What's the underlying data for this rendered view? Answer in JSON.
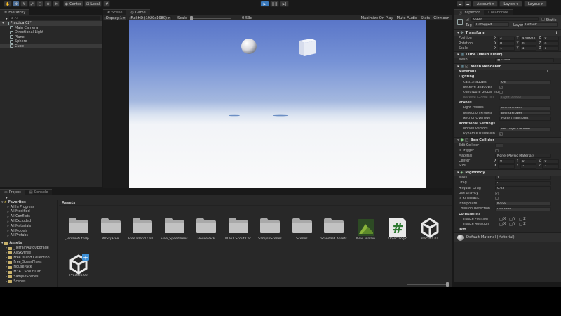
{
  "toolbar": {
    "pivot": "Center",
    "space": "Local",
    "account": "Account",
    "layers": "Layers",
    "layout": "Layout"
  },
  "hierarchy": {
    "tab": "Hierarchy",
    "search_placeholder": "All",
    "scene": "Practica 02*",
    "items": [
      "Main Camera",
      "Directional Light",
      "Plane",
      "Sphere",
      "Cube"
    ]
  },
  "game": {
    "tabs": [
      "Scene",
      "Game"
    ],
    "display": "Display 1",
    "resolution": "Full HD (1920x1080)",
    "scale_label": "Scale",
    "scale_value": "0.53x",
    "options": [
      "Maximize On Play",
      "Mute Audio",
      "Stats",
      "Gizmos"
    ]
  },
  "inspector": {
    "tabs": [
      "Inspector",
      "Collaborate"
    ],
    "object_name": "Cube",
    "static_label": "Static",
    "tag_label": "Tag",
    "tag_value": "Untagged",
    "layer_label": "Layer",
    "layer_value": "Default",
    "transform": {
      "title": "Transform",
      "position": {
        "label": "Position",
        "x": "2",
        "y": "4.98622",
        "z": "0"
      },
      "rotation": {
        "label": "Rotation",
        "x": "0",
        "y": "0",
        "z": "0"
      },
      "scale": {
        "label": "Scale",
        "x": "1",
        "y": "1",
        "z": "1"
      }
    },
    "mesh_filter": {
      "title": "Cube (Mesh Filter)",
      "mesh_label": "Mesh",
      "mesh_value": "Cube"
    },
    "mesh_renderer": {
      "title": "Mesh Renderer",
      "materials_label": "Materials",
      "materials_count": "1",
      "lighting_label": "Lighting",
      "cast_shadows_label": "Cast Shadows",
      "cast_shadows_value": "On",
      "receive_shadows_label": "Receive Shadows",
      "contribute_gi_label": "Contribute Global Illu",
      "receive_gi_label": "Receive Global Illu",
      "receive_gi_value": "Light Probes",
      "probes_label": "Probes",
      "light_probes_label": "Light Probes",
      "light_probes_value": "Blend Probes",
      "reflection_probes_label": "Reflection Probes",
      "reflection_probes_value": "Blend Probes",
      "anchor_override_label": "Anchor Override",
      "anchor_override_value": "None (Transform)",
      "additional_label": "Additional Settings",
      "motion_vectors_label": "Motion Vectors",
      "motion_vectors_value": "Per Object Motion",
      "dynamic_occlusion_label": "Dynamic Occlusion"
    },
    "box_collider": {
      "title": "Box Collider",
      "edit_collider_label": "Edit Collider",
      "is_trigger_label": "Is Trigger",
      "material_label": "Material",
      "material_value": "None (Physic Material)",
      "center": {
        "label": "Center",
        "x": "0",
        "y": "0",
        "z": "0"
      },
      "size": {
        "label": "Size",
        "x": "1",
        "y": "1",
        "z": "1"
      }
    },
    "rigidbody": {
      "title": "Rigidbody",
      "mass_label": "Mass",
      "mass_value": "1",
      "drag_label": "Drag",
      "drag_value": "0",
      "angular_drag_label": "Angular Drag",
      "angular_drag_value": "0.05",
      "use_gravity_label": "Use Gravity",
      "is_kinematic_label": "Is Kinematic",
      "interpolate_label": "Interpolate",
      "interpolate_value": "None",
      "collision_label": "Collision Detection",
      "collision_value": "Discrete",
      "constraints_label": "Constraints",
      "freeze_position_label": "Freeze Position",
      "freeze_rotation_label": "Freeze Rotation",
      "axes": [
        "X",
        "Y",
        "Z"
      ],
      "info_label": "Info"
    },
    "material": {
      "title": "Default-Material (Material)"
    }
  },
  "project": {
    "tabs": [
      "Project",
      "Console"
    ],
    "favorites_label": "Favorites",
    "favorites": [
      "All In Progress",
      "All Modified",
      "All Conflicts",
      "All Excluded",
      "All Materials",
      "All Models",
      "All Prefabs"
    ],
    "assets_label": "Assets",
    "folders": [
      "_TerrainAutoUpgrade",
      "AllSkyFree",
      "Free Island Collection",
      "Free_SpeedTrees",
      "HousePack",
      "M3A1 Scout Car",
      "SampleScenes",
      "Scenes"
    ],
    "breadcrumb": "Assets",
    "grid": [
      {
        "name": "_TerrainAutoUpg...",
        "kind": "folder"
      },
      {
        "name": "AllSkyFree",
        "kind": "folder"
      },
      {
        "name": "Free Island Collec...",
        "kind": "folder"
      },
      {
        "name": "Free_SpeedTrees",
        "kind": "folder"
      },
      {
        "name": "HousePack",
        "kind": "folder"
      },
      {
        "name": "M3A1 Scout Car",
        "kind": "folder"
      },
      {
        "name": "SampleScenes",
        "kind": "folder"
      },
      {
        "name": "Scenes",
        "kind": "folder"
      },
      {
        "name": "Standard Assets",
        "kind": "folder"
      },
      {
        "name": "New Terrain",
        "kind": "terrain"
      },
      {
        "name": "ObjectLogic",
        "kind": "script"
      },
      {
        "name": "Practica 01",
        "kind": "unity"
      },
      {
        "name": "Practica 02",
        "kind": "unity-new"
      }
    ]
  }
}
